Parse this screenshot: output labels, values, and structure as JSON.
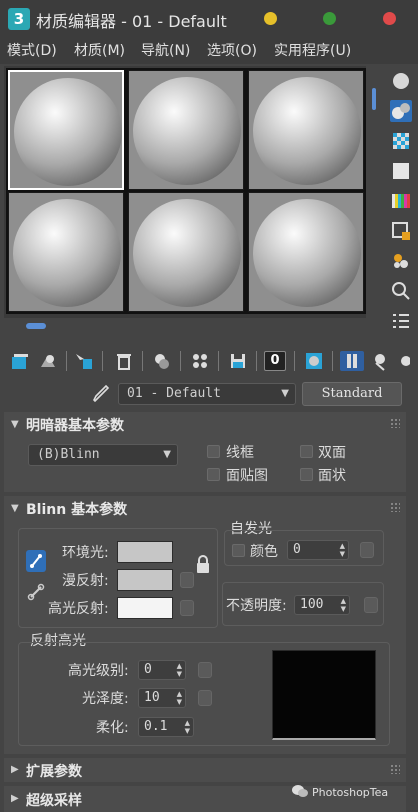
{
  "window": {
    "title": "材质编辑器 - 01 - Default",
    "app_icon_glyph": "3",
    "controls": {
      "minimize_color": "#e6c02a",
      "maximize_color": "#3a9a3a",
      "close_color": "#e04a4a"
    }
  },
  "menu": {
    "items": [
      {
        "label": "模式(D)"
      },
      {
        "label": "材质(M)"
      },
      {
        "label": "导航(N)"
      },
      {
        "label": "选项(O)"
      },
      {
        "label": "实用程序(U)"
      }
    ]
  },
  "sample_slots": {
    "count": 6,
    "selected_index": 0,
    "side_icons": [
      "sphere-icon",
      "sample-type-icon",
      "checker-background-icon",
      "backlight-icon",
      "color-bars-icon",
      "video-check-icon",
      "make-preview-icon",
      "options-icon",
      "select-by-material-icon",
      "material-map-navigator-icon"
    ]
  },
  "toolbar": {
    "icons": [
      "get-material-icon",
      "put-to-scene-icon",
      "assign-to-selection-icon",
      "reset-map-icon",
      "make-unique-icon",
      "copy-material-icon",
      "put-to-library-icon",
      "material-id-channel-icon",
      "show-in-viewport-icon",
      "show-end-result-icon",
      "go-to-parent-icon",
      "go-forward-icon"
    ],
    "material_id_value": "0"
  },
  "material": {
    "name": "01 - Default",
    "type_button": "Standard"
  },
  "shader_basic": {
    "title": "明暗器基本参数",
    "shader_value": "(B)Blinn",
    "wire_label": "线框",
    "two_sided_label": "双面",
    "face_map_label": "面贴图",
    "faceted_label": "面状"
  },
  "blinn_basic": {
    "title": "Blinn 基本参数",
    "ambient_label": "环境光:",
    "diffuse_label": "漫反射:",
    "specular_label": "高光反射:",
    "ambient_color": "#c6c6c6",
    "diffuse_color": "#c6c6c6",
    "specular_color": "#f4f4f4",
    "self_illum": {
      "title": "自发光",
      "color_label": "颜色",
      "value": "0"
    },
    "opacity": {
      "label": "不透明度:",
      "value": "100"
    },
    "specular_highlights": {
      "title": "反射高光",
      "level_label": "高光级别:",
      "level_value": "0",
      "gloss_label": "光泽度:",
      "gloss_value": "10",
      "soften_label": "柔化:",
      "soften_value": "0.1"
    }
  },
  "extended_params": {
    "title": "扩展参数"
  },
  "supersampling": {
    "title": "超级采样"
  },
  "watermark": {
    "text": "PhotoshopTea"
  }
}
